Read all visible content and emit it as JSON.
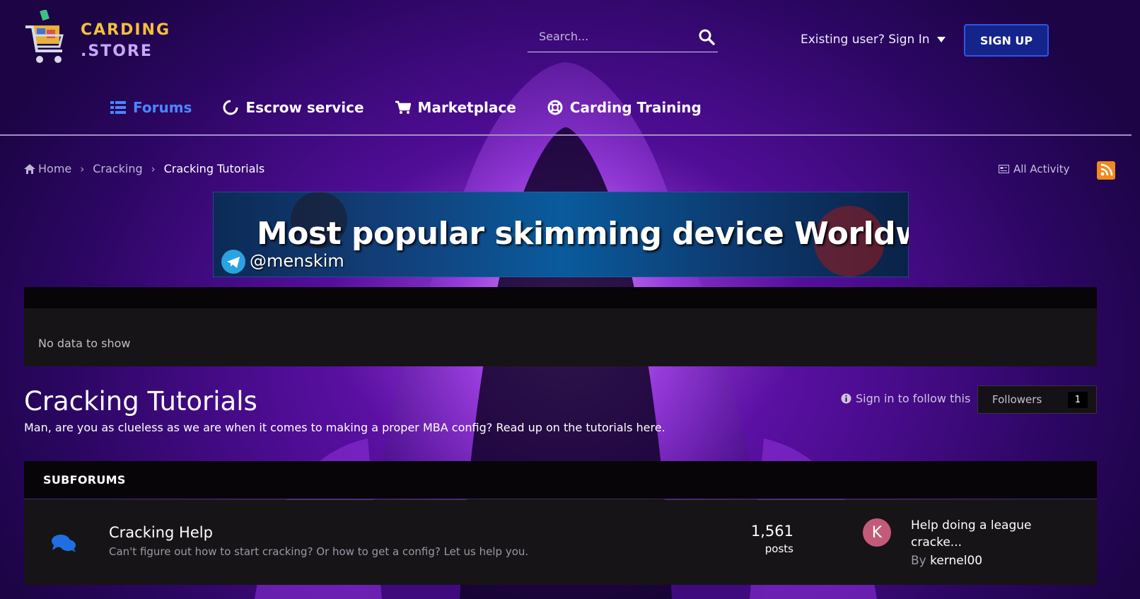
{
  "brand": {
    "line1": "CARDING",
    "line2": ".STORE",
    "logo_icon": "shopping-cart-icon"
  },
  "header": {
    "search_placeholder": "Search...",
    "signin_label": "Existing user? Sign In",
    "signup_label": "SIGN UP"
  },
  "nav": [
    {
      "label": "Forums",
      "icon": "list-icon",
      "active": true
    },
    {
      "label": "Escrow service",
      "icon": "circle-notch-icon",
      "active": false
    },
    {
      "label": "Marketplace",
      "icon": "shopping-cart-icon",
      "active": false
    },
    {
      "label": "Carding Training",
      "icon": "life-ring-icon",
      "active": false
    }
  ],
  "breadcrumb": {
    "home": "Home",
    "parent": "Cracking",
    "current": "Cracking Tutorials"
  },
  "activity": {
    "label": "All Activity"
  },
  "banner": {
    "title": "Most popular skimming device Worldwide",
    "handle": "@menskim"
  },
  "data_panel": {
    "empty_text": "No data to show"
  },
  "forum": {
    "title": "Cracking Tutorials",
    "description": "Man, are you as clueless as we are when it comes to making a proper MBA config? Read up on the tutorials here.",
    "follow_text": "Sign in to follow this",
    "followers_label": "Followers",
    "followers_count": "1"
  },
  "subforums": {
    "heading": "SUBFORUMS",
    "items": [
      {
        "title": "Cracking Help",
        "description": "Can't figure out how to start cracking? Or how to get a config? Let us help you.",
        "posts_count": "1,561",
        "posts_label": "posts",
        "avatar_letter": "K",
        "last_post_title": "Help doing a league cracke...",
        "last_post_by": "By",
        "last_post_author": "kernel00"
      }
    ]
  },
  "colors": {
    "accent": "#4c86ff",
    "signup_bg": "#14248a",
    "logo_gold": "#f4c03a",
    "rss": "#f08a1f",
    "avatar": "#c45a7a"
  }
}
